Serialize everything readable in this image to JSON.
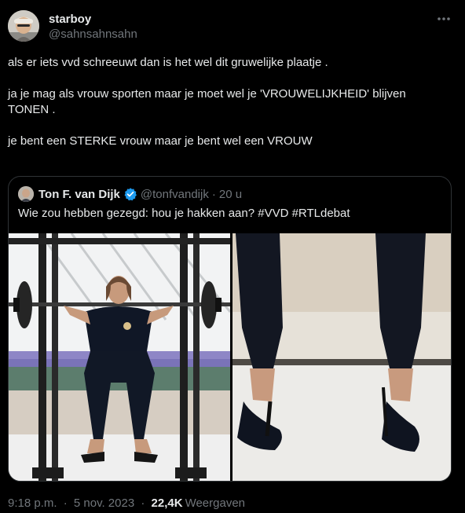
{
  "tweet": {
    "display_name": "starboy",
    "handle": "@sahnsahnsahn",
    "more_icon": "more-icon",
    "paragraphs": [
      "als er iets vvd schreeuwt dan is het wel dit gruwelijke plaatje .",
      "ja je mag als vrouw sporten maar je moet wel je 'VROUWELIJKHEID' blijven TONEN .",
      "je bent een STERKE vrouw maar je bent wel een VROUW"
    ]
  },
  "quote": {
    "display_name": "Ton F. van Dijk",
    "verified_icon": "verified-badge-icon",
    "verified_color": "#1d9bf0",
    "handle": "@tonfvandijk",
    "separator": "·",
    "time": "20 u",
    "text": "Wie zou hebben gezegd: hou je hakken aan? #VVD #RTLdebat"
  },
  "meta": {
    "time": "9:18 p.m.",
    "separator": "·",
    "date": "5 nov. 2023",
    "separator2": "·",
    "views_count": "22,4K",
    "views_label": "Weergaven"
  },
  "colors": {
    "background": "#000000",
    "text": "#e7e9ea",
    "secondary_text": "#71767b",
    "border": "#2f3336",
    "accent": "#1d9bf0"
  }
}
